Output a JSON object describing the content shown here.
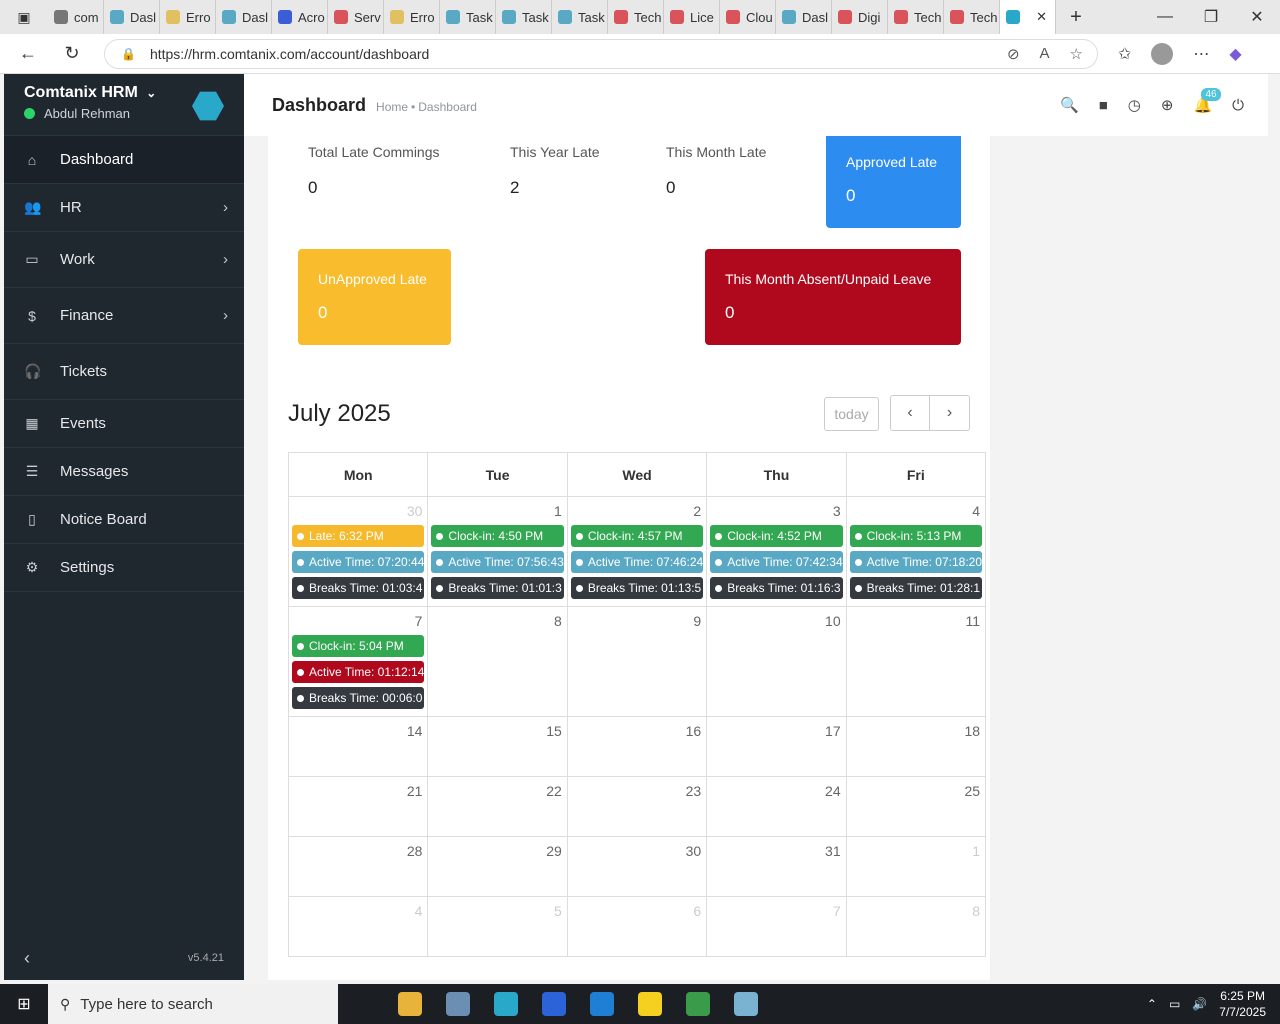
{
  "browser": {
    "tabs": [
      {
        "label": "com",
        "color": "#777"
      },
      {
        "label": "Dasl",
        "color": "#5aa9c4"
      },
      {
        "label": "Erro",
        "color": "#e0c060"
      },
      {
        "label": "Dasl",
        "color": "#5aa9c4"
      },
      {
        "label": "Acro",
        "color": "#3b5ed6"
      },
      {
        "label": "Serv",
        "color": "#d9535a"
      },
      {
        "label": "Erro",
        "color": "#e0c060"
      },
      {
        "label": "Task",
        "color": "#5aa9c4"
      },
      {
        "label": "Task",
        "color": "#5aa9c4"
      },
      {
        "label": "Task",
        "color": "#5aa9c4"
      },
      {
        "label": "Tech",
        "color": "#d9535a"
      },
      {
        "label": "Lice",
        "color": "#d9535a"
      },
      {
        "label": "Clou",
        "color": "#d9535a"
      },
      {
        "label": "Dasl",
        "color": "#5aa9c4"
      },
      {
        "label": "Digi",
        "color": "#d9535a"
      },
      {
        "label": "Tech",
        "color": "#d9535a"
      },
      {
        "label": "Tech",
        "color": "#d9535a"
      }
    ],
    "url": "https://hrm.comtanix.com/account/dashboard"
  },
  "sidebar": {
    "brand": "Comtanix HRM",
    "user": "Abdul Rehman",
    "items": [
      {
        "label": "Dashboard",
        "icon": "⌂",
        "chev": false,
        "h": 48,
        "active": true
      },
      {
        "label": "HR",
        "icon": "👥",
        "chev": true,
        "h": 48
      },
      {
        "label": "Work",
        "icon": "▭",
        "chev": true,
        "h": 56
      },
      {
        "label": "Finance",
        "icon": "$",
        "chev": true,
        "h": 56
      },
      {
        "label": "Tickets",
        "icon": "🎧",
        "chev": false,
        "h": 56
      },
      {
        "label": "Events",
        "icon": "▦",
        "chev": false,
        "h": 48
      },
      {
        "label": "Messages",
        "icon": "☰",
        "chev": false,
        "h": 48
      },
      {
        "label": "Notice Board",
        "icon": "▯",
        "chev": false,
        "h": 48
      },
      {
        "label": "Settings",
        "icon": "⚙",
        "chev": false,
        "h": 48
      }
    ],
    "version": "v5.4.21"
  },
  "header": {
    "title": "Dashboard",
    "crumb_home": "Home",
    "crumb_current": "Dashboard",
    "notif_count": "46"
  },
  "stats": {
    "total_late_label": "Total Late Commings",
    "total_late": "0",
    "year_late_label": "This Year Late",
    "year_late": "2",
    "month_late_label": "This Month Late",
    "month_late": "0",
    "approved_label": "Approved Late",
    "approved": "0",
    "unapproved_label": "UnApproved Late",
    "unapproved": "0",
    "absent_label": "This Month Absent/Unpaid Leave",
    "absent": "0"
  },
  "calendar": {
    "title": "July 2025",
    "today_label": "today",
    "days": [
      "Mon",
      "Tue",
      "Wed",
      "Thu",
      "Fri"
    ],
    "weeks": [
      {
        "h": 110,
        "cells": [
          {
            "n": "30",
            "muted": true,
            "events": [
              {
                "t": "Late: 6:32 PM",
                "c": "#f6b92b"
              },
              {
                "t": "Active Time: 07:20:44",
                "c": "#5aa9c4"
              },
              {
                "t": "Breaks Time: 01:03:4",
                "c": "#343a40"
              }
            ]
          },
          {
            "n": "1",
            "events": [
              {
                "t": "Clock-in: 4:50 PM",
                "c": "#33a852"
              },
              {
                "t": "Active Time: 07:56:43",
                "c": "#5aa9c4"
              },
              {
                "t": "Breaks Time: 01:01:3",
                "c": "#343a40"
              }
            ]
          },
          {
            "n": "2",
            "events": [
              {
                "t": "Clock-in: 4:57 PM",
                "c": "#33a852"
              },
              {
                "t": "Active Time: 07:46:24",
                "c": "#5aa9c4"
              },
              {
                "t": "Breaks Time: 01:13:5",
                "c": "#343a40"
              }
            ]
          },
          {
            "n": "3",
            "events": [
              {
                "t": "Clock-in: 4:52 PM",
                "c": "#33a852"
              },
              {
                "t": "Active Time: 07:42:34",
                "c": "#5aa9c4"
              },
              {
                "t": "Breaks Time: 01:16:3",
                "c": "#343a40"
              }
            ]
          },
          {
            "n": "4",
            "events": [
              {
                "t": "Clock-in: 5:13 PM",
                "c": "#33a852"
              },
              {
                "t": "Active Time: 07:18:20",
                "c": "#5aa9c4"
              },
              {
                "t": "Breaks Time: 01:28:1",
                "c": "#343a40"
              }
            ]
          }
        ]
      },
      {
        "h": 110,
        "cells": [
          {
            "n": "7",
            "events": [
              {
                "t": "Clock-in: 5:04 PM",
                "c": "#33a852"
              },
              {
                "t": "Active Time: 01:12:14",
                "c": "#b0081d"
              },
              {
                "t": "Breaks Time: 00:06:0",
                "c": "#343a40"
              }
            ]
          },
          {
            "n": "8",
            "events": []
          },
          {
            "n": "9",
            "events": []
          },
          {
            "n": "10",
            "events": []
          },
          {
            "n": "11",
            "events": []
          }
        ]
      },
      {
        "h": 60,
        "cells": [
          {
            "n": "14"
          },
          {
            "n": "15"
          },
          {
            "n": "16"
          },
          {
            "n": "17"
          },
          {
            "n": "18"
          }
        ]
      },
      {
        "h": 60,
        "cells": [
          {
            "n": "21"
          },
          {
            "n": "22"
          },
          {
            "n": "23"
          },
          {
            "n": "24"
          },
          {
            "n": "25"
          }
        ]
      },
      {
        "h": 60,
        "cells": [
          {
            "n": "28"
          },
          {
            "n": "29"
          },
          {
            "n": "30"
          },
          {
            "n": "31"
          },
          {
            "n": "1",
            "muted": true
          }
        ]
      },
      {
        "h": 60,
        "cells": [
          {
            "n": "4",
            "muted": true
          },
          {
            "n": "5",
            "muted": true
          },
          {
            "n": "6",
            "muted": true
          },
          {
            "n": "7",
            "muted": true
          },
          {
            "n": "8",
            "muted": true
          }
        ]
      }
    ]
  },
  "colors": {
    "blue": "#2d8cf0",
    "yellow": "#f8bc2c",
    "red": "#b0081d"
  },
  "taskbar": {
    "search_placeholder": "Type here to search",
    "time": "6:25 PM",
    "date": "7/7/2025",
    "apps": [
      "#e8b33b",
      "#6a8fb3",
      "#2aa8c9",
      "#2d63d8",
      "#1e7fd4",
      "#f5d020",
      "#3a9b4a",
      "#7ab3d1"
    ]
  }
}
